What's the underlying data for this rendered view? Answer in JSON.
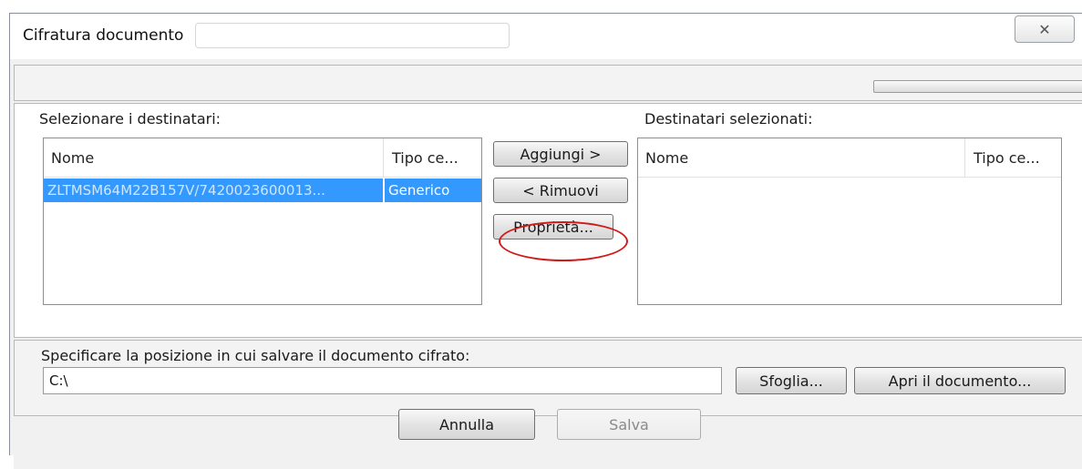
{
  "window": {
    "title": "Cifratura documento",
    "close_glyph": "✕"
  },
  "left_list": {
    "label": "Selezionare i destinatari:",
    "columns": [
      "Nome",
      "Tipo ce..."
    ],
    "rows": [
      {
        "name": "ZLTMSM64M22B157V/7420023600013...",
        "type": "Generico",
        "selected": true
      }
    ]
  },
  "actions": {
    "add": "Aggiungi >",
    "remove": "< Rimuovi",
    "properties": "Proprietà..."
  },
  "right_list": {
    "label": "Destinatari selezionati:",
    "columns": [
      "Nome",
      "Tipo ce..."
    ]
  },
  "save_location": {
    "label": "Specificare la posizione in cui salvare il documento cifrato:",
    "path": "C:\\",
    "browse": "Sfoglia...",
    "open_document": "Apri il documento..."
  },
  "footer": {
    "cancel": "Annulla",
    "save": "Salva"
  },
  "colors": {
    "selection": "#3399ff",
    "highlight_circle": "#d11a1a"
  }
}
